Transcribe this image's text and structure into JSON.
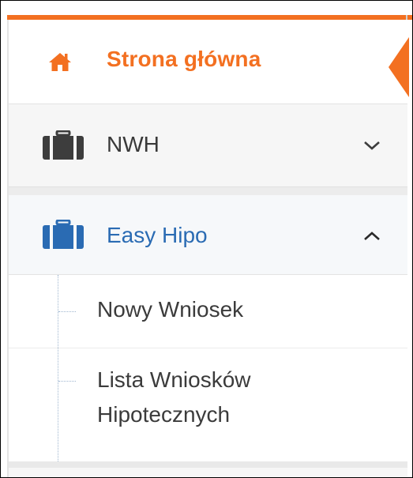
{
  "sidebar": {
    "home": {
      "label": "Strona główna",
      "icon": "home-icon",
      "active": true
    },
    "items": [
      {
        "label": "NWH",
        "icon": "briefcase-icon",
        "expanded": false,
        "chevron": "chevron-down-icon"
      },
      {
        "label": "Easy Hipo",
        "icon": "briefcase-icon",
        "expanded": true,
        "chevron": "chevron-up-icon",
        "children": [
          {
            "label": "Nowy Wniosek"
          },
          {
            "label": "Lista Wniosków Hipotecznych"
          }
        ]
      }
    ]
  },
  "colors": {
    "accent": "#f37021",
    "active_blue": "#2a6bb3",
    "text_dark": "#393939",
    "icon_dark": "#3d3d3d"
  }
}
